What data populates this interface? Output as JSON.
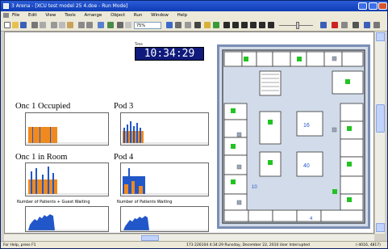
{
  "window": {
    "title": "3 Arena - [XCU test model 25 4.doe - Run Mode]",
    "controls": [
      "minimize",
      "maximize",
      "close"
    ]
  },
  "menu": [
    "File",
    "Edit",
    "View",
    "Tools",
    "Arrange",
    "Object",
    "Run",
    "Window",
    "Help"
  ],
  "toolbar": {
    "zoom_value": "75%"
  },
  "clock": {
    "label": "Time",
    "value": "10:34:29"
  },
  "panels": {
    "onc1_occupied": "Onc 1 Occupied",
    "pod3": "Pod 3",
    "onc1_in_room": "Onc 1 in Room",
    "pod4": "Pod 4",
    "patients_guests_waiting": "Number of Patients + Guest Waiting",
    "patients_waiting": "Number of Patients Waiting"
  },
  "map_labels": [
    "16",
    "40",
    "10",
    "4"
  ],
  "colors": {
    "orange": "#f08a1e",
    "blue": "#2157c8",
    "green": "#22c322",
    "clock_bg": "#101a7c",
    "map_bg": "#cfd8e6"
  },
  "status": {
    "help": "For Help, press F1",
    "runinfo": "173   226104 4:34:29 Runsday, December 22, 2010  User Interrupted",
    "coords": "(-4016, 4817)"
  }
}
